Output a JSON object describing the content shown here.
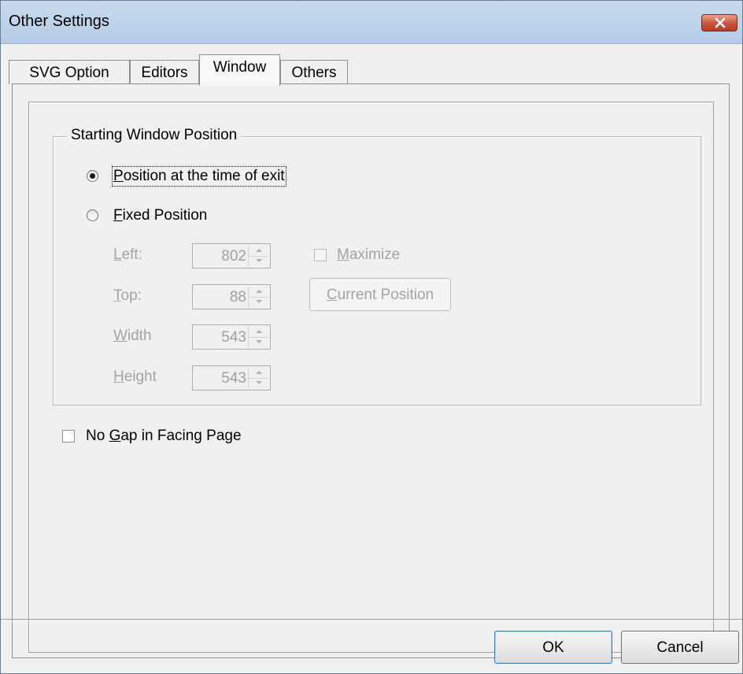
{
  "window": {
    "title": "Other Settings",
    "close_icon": "close-icon"
  },
  "tabs": [
    {
      "label": "SVG Option",
      "active": false
    },
    {
      "label": "Editors",
      "active": false
    },
    {
      "label": "Window",
      "active": true
    },
    {
      "label": "Others",
      "active": false
    }
  ],
  "group": {
    "label": "Starting Window Position"
  },
  "radios": {
    "exit": {
      "label": "Position at the time of exit",
      "selected": true
    },
    "fixed": {
      "label": "Fixed Position",
      "selected": false
    }
  },
  "fields": {
    "left": {
      "label": "Left:",
      "value": "802"
    },
    "top": {
      "label": "Top:",
      "value": "88"
    },
    "width": {
      "label": "Width",
      "value": "543"
    },
    "height": {
      "label": "Height",
      "value": "543"
    }
  },
  "maximize": {
    "label": "Maximize",
    "checked": false,
    "enabled": false
  },
  "current_position": {
    "label": "Current Position",
    "enabled": false
  },
  "no_gap": {
    "label": "No Gap in Facing Page",
    "checked": false
  },
  "buttons": {
    "ok": "OK",
    "cancel": "Cancel"
  },
  "colors": {
    "titlebar": "#bcd1e9",
    "close": "#c8533a",
    "face": "#f0f0f0",
    "disabled_text": "#a3a3a3"
  }
}
